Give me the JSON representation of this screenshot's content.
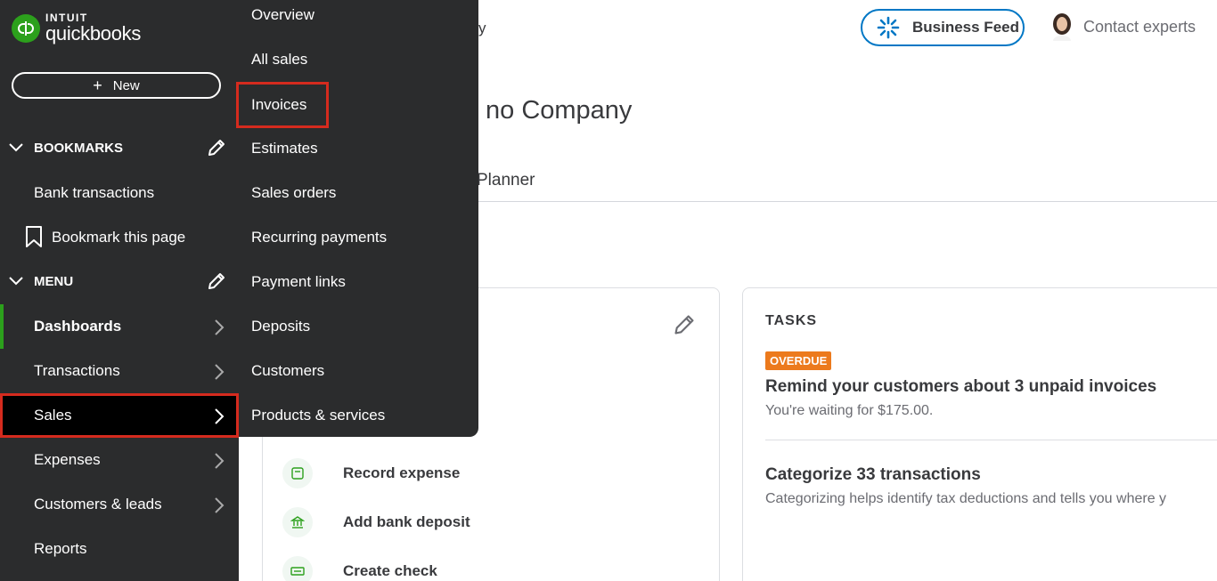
{
  "logo": {
    "brand": "INTUIT",
    "product": "quickbooks"
  },
  "sidebar": {
    "new_label": "New",
    "bookmarks": {
      "title": "BOOKMARKS",
      "items": [
        "Bank transactions",
        "Bookmark this page"
      ]
    },
    "menu": {
      "title": "MENU",
      "items": [
        "Dashboards",
        "Transactions",
        "Sales",
        "Expenses",
        "Customers & leads",
        "Reports"
      ]
    }
  },
  "sales_flyout": {
    "items": [
      "Overview",
      "All sales",
      "Invoices",
      "Estimates",
      "Sales orders",
      "Recurring payments",
      "Payment links",
      "Deposits",
      "Customers",
      "Products & services"
    ]
  },
  "header": {
    "fragment": "y",
    "business_feed": "Business Feed",
    "contact_experts": "Contact experts"
  },
  "main": {
    "company_title_fragment": "no Company",
    "tab_fragment": "Planner",
    "quick_actions": [
      "Record expense",
      "Add bank deposit",
      "Create check"
    ],
    "tasks": {
      "title": "TASKS",
      "badge": "OVERDUE",
      "task1_title": "Remind your customers about 3 unpaid invoices",
      "task1_sub": "You're waiting for $175.00.",
      "task2_title": "Categorize 33 transactions",
      "task2_sub": "Categorizing helps identify tax deductions and tells you where y"
    }
  },
  "colors": {
    "sidebar_bg": "#2b2c2d",
    "brand_green": "#2ca01c",
    "highlight_red": "#d52b1e",
    "link_blue": "#0077c5",
    "overdue_orange": "#ec7a1d"
  }
}
